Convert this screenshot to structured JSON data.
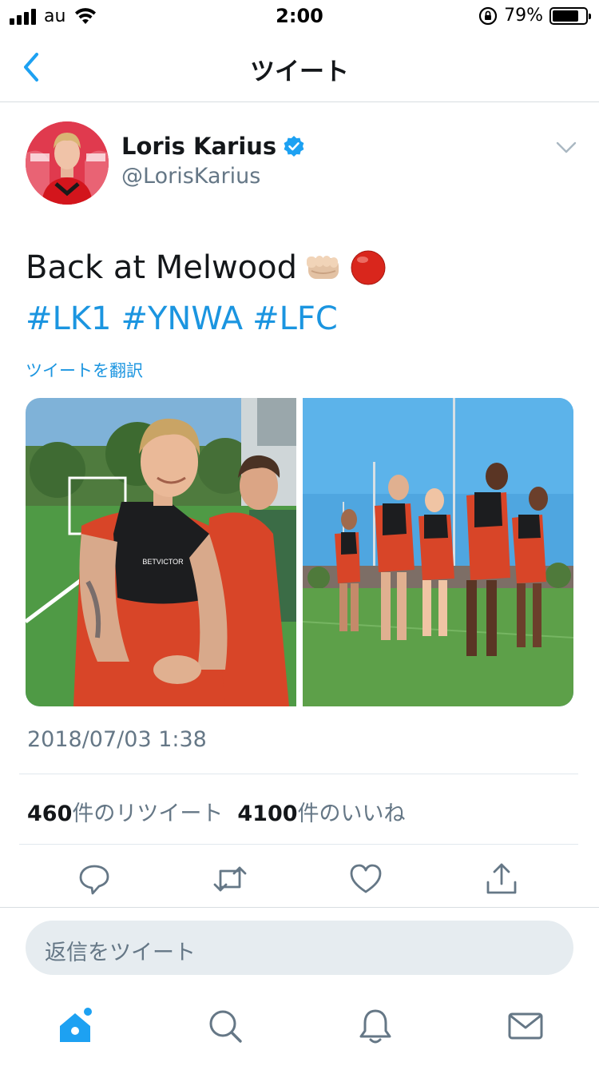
{
  "status_bar": {
    "carrier": "au",
    "time": "2:00",
    "battery_percent": "79%",
    "battery_level": 0.79
  },
  "nav": {
    "title": "ツイート",
    "back_icon": "chevron-left-icon"
  },
  "tweet": {
    "author_name": "Loris Karius",
    "author_handle": "@LorisKarius",
    "verified": true,
    "text": "Back at Melwood",
    "emojis": [
      "fist-bump-emoji",
      "red-circle-emoji"
    ],
    "hashtags": [
      "#LK1",
      "#YNWA",
      "#LFC"
    ],
    "translate_label": "ツイートを翻訳",
    "timestamp": "2018/07/03 1:38",
    "retweet_count": "460",
    "retweet_label": "件のリツイート",
    "like_count": "4100",
    "like_label": "件のいいね"
  },
  "photos": [
    {
      "alt_icon": "photo-player-smiling"
    },
    {
      "alt_icon": "photo-team-running"
    }
  ],
  "actions": [
    "reply-icon",
    "retweet-icon",
    "like-icon",
    "share-icon"
  ],
  "reply_box": {
    "placeholder": "返信をツイート"
  },
  "tab_bar": {
    "items": [
      "home-icon",
      "search-icon",
      "notifications-icon",
      "messages-icon"
    ],
    "accent": "#1da1f2"
  },
  "colors": {
    "link": "#1b95e0",
    "secondary_text": "#657786",
    "avatar_bg": "#e03a4e"
  }
}
